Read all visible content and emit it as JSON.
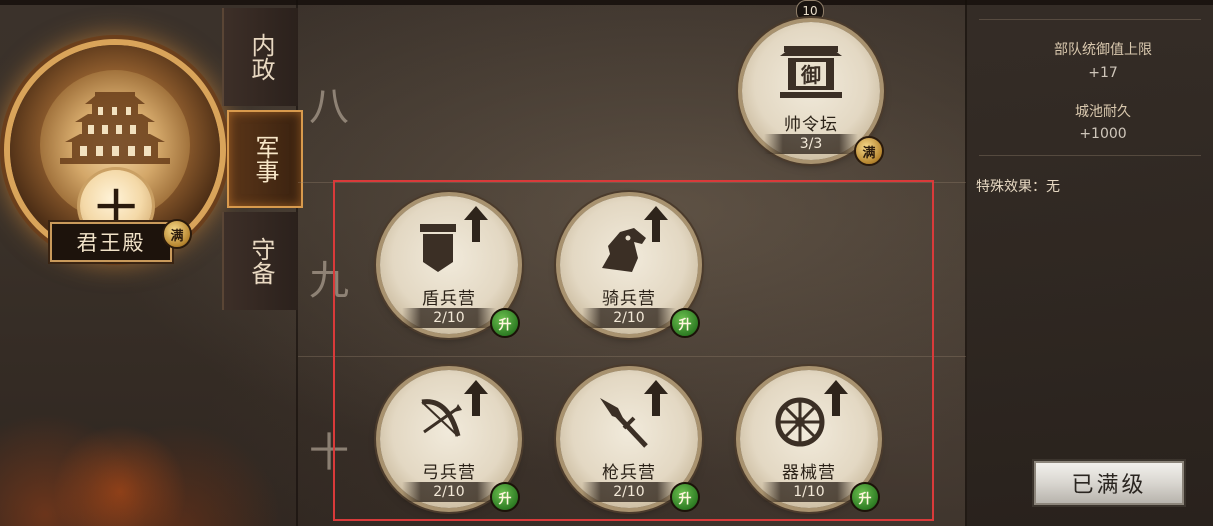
{
  "hall": {
    "name": "君王殿",
    "level": "十",
    "max_badge": "满"
  },
  "tabs": [
    {
      "label": "内政",
      "active": false
    },
    {
      "label": "军事",
      "active": true
    },
    {
      "label": "守备",
      "active": false
    }
  ],
  "rows": [
    "八",
    "九",
    "十"
  ],
  "top_count": "10",
  "buildings": {
    "shuaiLingTan": {
      "name": "帅令坛",
      "count": "3/3",
      "badge": "满",
      "icon_text": "御"
    },
    "dunBingYing": {
      "name": "盾兵营",
      "count": "2/10",
      "badge": "升"
    },
    "qiBingYing": {
      "name": "骑兵营",
      "count": "2/10",
      "badge": "升"
    },
    "gongBingYing": {
      "name": "弓兵营",
      "count": "2/10",
      "badge": "升"
    },
    "qiangBingYing": {
      "name": "枪兵营",
      "count": "2/10",
      "badge": "升"
    },
    "qiXieYing": {
      "name": "器械营",
      "count": "1/10",
      "badge": "升"
    }
  },
  "panel": {
    "stat1_label": "部队统御值上限",
    "stat1_value": "+17",
    "stat2_label": "城池耐久",
    "stat2_value": "+1000",
    "special_effect": "特殊效果：无",
    "maxed_button": "已满级"
  },
  "colors": {
    "highlight": "#d93a3a",
    "upgrade_badge": "#2f7d24",
    "max_badge": "#b7862f",
    "active_tab_border": "#d89a4d"
  }
}
